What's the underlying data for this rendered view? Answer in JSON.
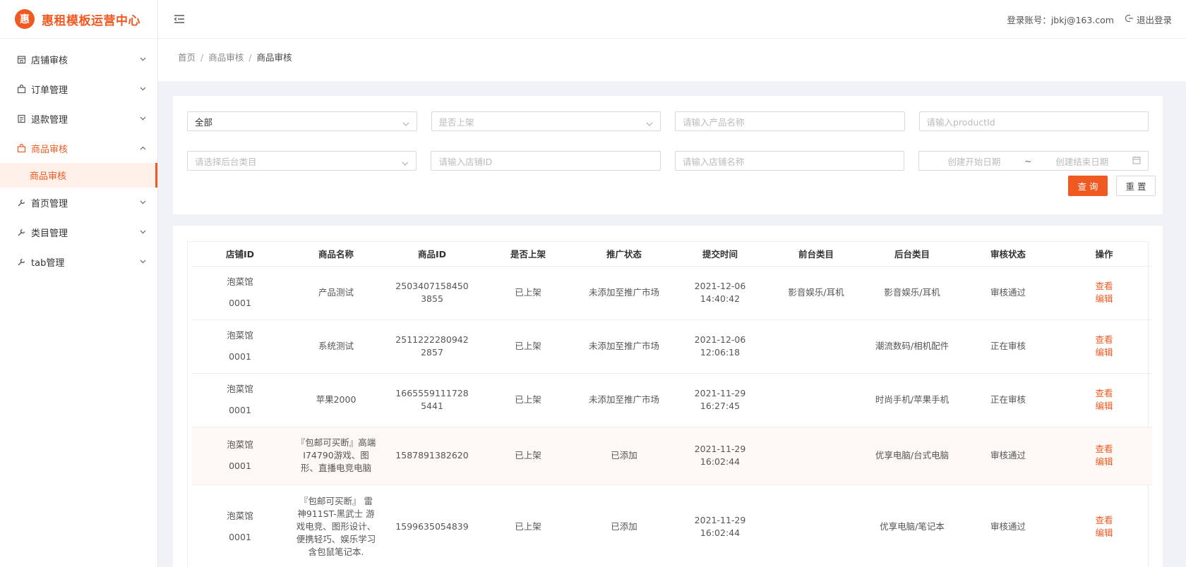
{
  "app": {
    "logo_char": "惠",
    "title": "惠租模板运营中心"
  },
  "header": {
    "account_label": "登录账号：jbkj@163.com",
    "logout_label": "退出登录"
  },
  "sidebar": {
    "items": [
      {
        "label": "店铺审核"
      },
      {
        "label": "订单管理"
      },
      {
        "label": "退款管理"
      },
      {
        "label": "商品审核",
        "active": true,
        "children": [
          {
            "label": "商品审核"
          }
        ]
      },
      {
        "label": "首页管理"
      },
      {
        "label": "类目管理"
      },
      {
        "label": "tab管理"
      }
    ]
  },
  "breadcrumb": [
    "首页",
    "商品审核",
    "商品审核"
  ],
  "filters": {
    "status_select": "全部",
    "shelf_placeholder": "是否上架",
    "product_name_placeholder": "请输入产品名称",
    "product_id_placeholder": "请输入productId",
    "category_placeholder": "请选择后台类目",
    "shop_id_placeholder": "请输入店铺ID",
    "shop_name_placeholder": "请输入店铺名称",
    "start_date_placeholder": "创建开始日期",
    "range_sep": "~",
    "end_date_placeholder": "创建结束日期",
    "search_label": "查 询",
    "reset_label": "重 置"
  },
  "table": {
    "columns": [
      "店铺ID",
      "商品名称",
      "商品ID",
      "是否上架",
      "推广状态",
      "提交时间",
      "前台类目",
      "后台类目",
      "审核状态",
      "操作"
    ],
    "view_label": "查看",
    "edit_label": "编辑",
    "rows": [
      {
        "shop_name": "泡菜馆",
        "shop_id": "0001",
        "product": "产品测试",
        "product_id": "25034071584503855",
        "shelf": "已上架",
        "promo": "未添加至推广市场",
        "date": "2021-12-06",
        "time": "14:40:42",
        "front_cat": "影音娱乐/耳机",
        "back_cat": "影音娱乐/耳机",
        "audit": "审核通过"
      },
      {
        "shop_name": "泡菜馆",
        "shop_id": "0001",
        "product": "系统测试",
        "product_id": "25112222809422857",
        "shelf": "已上架",
        "promo": "未添加至推广市场",
        "date": "2021-12-06",
        "time": "12:06:18",
        "front_cat": "",
        "back_cat": "潮流数码/相机配件",
        "audit": "正在审核"
      },
      {
        "shop_name": "泡菜馆",
        "shop_id": "0001",
        "product": "苹果2000",
        "product_id": "16655591117285441",
        "shelf": "已上架",
        "promo": "未添加至推广市场",
        "date": "2021-11-29",
        "time": "16:27:45",
        "front_cat": "",
        "back_cat": "时尚手机/苹果手机",
        "audit": "正在审核"
      },
      {
        "shop_name": "泡菜馆",
        "shop_id": "0001",
        "product": "『包邮可买断』高端I74790游戏、图形、直播电竞电脑",
        "product_id": "1587891382620",
        "shelf": "已上架",
        "promo": "已添加",
        "date": "2021-11-29",
        "time": "16:02:44",
        "front_cat": "",
        "back_cat": "优享电脑/台式电脑",
        "audit": "审核通过"
      },
      {
        "shop_name": "泡菜馆",
        "shop_id": "0001",
        "product": "『包邮可买断』 雷神911ST-黑武士 游戏电竞、图形设计、便携轻巧、娱乐学习含包鼠笔记本.",
        "product_id": "1599635054839",
        "shelf": "已上架",
        "promo": "已添加",
        "date": "2021-11-29",
        "time": "16:02:44",
        "front_cat": "",
        "back_cat": "优享电脑/笔记本",
        "audit": "审核通过"
      }
    ]
  },
  "colors": {
    "accent": "#f05a22",
    "highlight_row": "#fdf8f4"
  }
}
